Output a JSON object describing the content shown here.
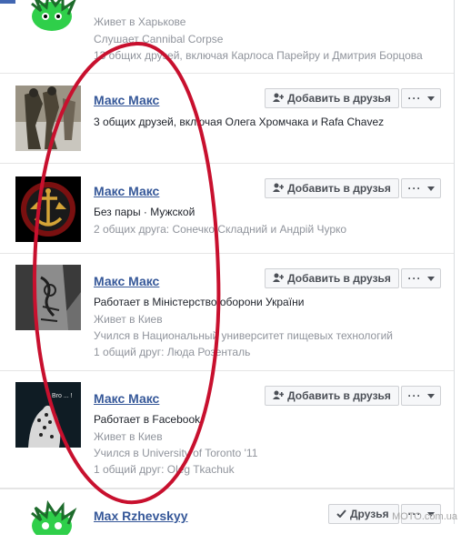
{
  "colors": {
    "link": "#365899",
    "oval": "#c8102e",
    "fb_blue": "#4267b2"
  },
  "icons": {
    "add_friend": "add-friend-icon",
    "more": "more-icon",
    "dropdown": "chevron-down-icon",
    "check": "check-icon"
  },
  "rows": [
    {
      "lines": [
        "Живет в Харькове",
        "Слушает Cannibal Corpse",
        "13 общих друзей, включая Карлоса Парейру и Дмитрия Борцова"
      ]
    },
    {
      "name": "Макс Макс",
      "lines": [
        "3 общих друзей, включая Олега Хромчака и Rafa Chavez"
      ],
      "add_label": "Добавить в друзья"
    },
    {
      "name": "Макс Макс",
      "lines": [
        "Без пары · Мужской",
        "2 общих друга: Сонечко Складний и Андрій Чурко"
      ],
      "add_label": "Добавить в друзья"
    },
    {
      "name": "Макс Макс",
      "lines": [
        "Работает в Міністерство оборони України",
        "Живет в Киев",
        "Учился в Национальный университет пищевых технологий",
        "1 общий друг: Люда Розенталь"
      ],
      "add_label": "Добавить в друзья"
    },
    {
      "name": "Макс Макс",
      "lines": [
        "Работает в Facebook",
        "Живет в Киев",
        "Учился в University of Toronto '11",
        "1 общий друг: Oleg Tkachuk"
      ],
      "add_label": "Добавить в друзья"
    },
    {
      "name": "Max Rzhevskyy",
      "friends_label": "Друзья"
    }
  ],
  "thumb_text": "Bro ... !",
  "watermark": "MOTO.com.ua"
}
